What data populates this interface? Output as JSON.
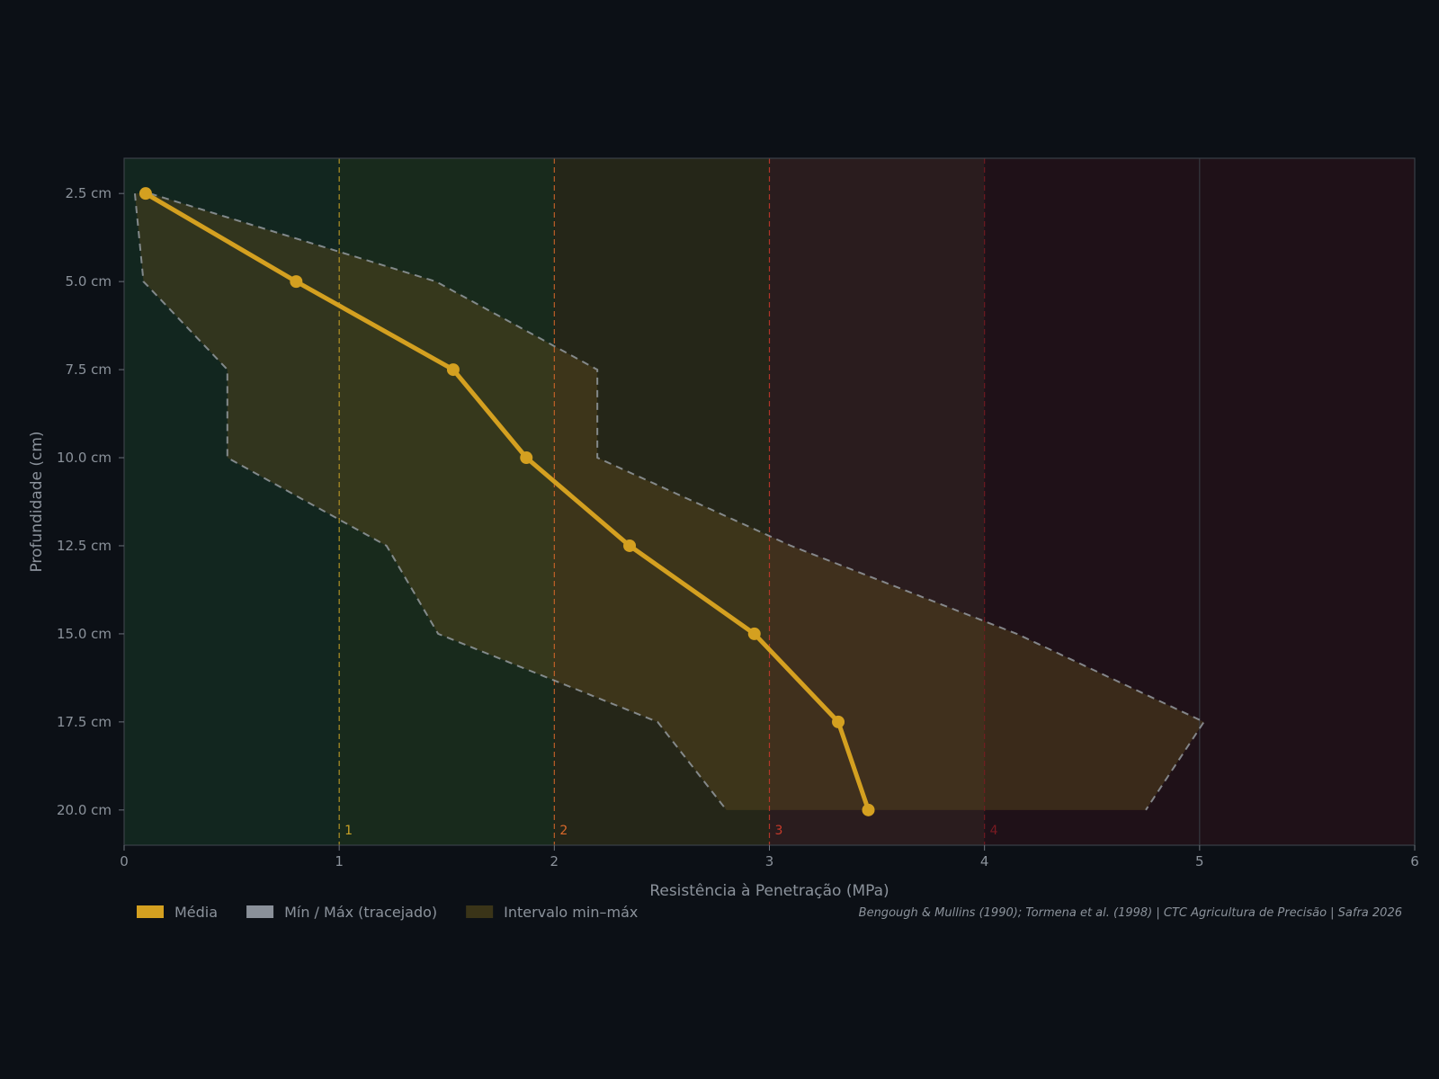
{
  "chart_data": {
    "type": "line",
    "title": "",
    "xlabel": "Resistência à Penetração (MPa)",
    "ylabel": "Profundidade (cm)",
    "xlim": [
      0,
      6
    ],
    "ylim": [
      21,
      1.5
    ],
    "y_inverted": true,
    "x_ticks": [
      "0",
      "1",
      "2",
      "3",
      "4",
      "5",
      "6"
    ],
    "y_ticks": [
      {
        "value": 2.5,
        "label": "2.5 cm"
      },
      {
        "value": 5.0,
        "label": "5.0 cm"
      },
      {
        "value": 7.5,
        "label": "7.5 cm"
      },
      {
        "value": 10.0,
        "label": "10.0 cm"
      },
      {
        "value": 12.5,
        "label": "12.5 cm"
      },
      {
        "value": 15.0,
        "label": "15.0 cm"
      },
      {
        "value": 17.5,
        "label": "17.5 cm"
      },
      {
        "value": 20.0,
        "label": "20.0 cm"
      }
    ],
    "depths": [
      2.5,
      5.0,
      7.5,
      10.0,
      12.5,
      15.0,
      17.5,
      20.0
    ],
    "zones": [
      {
        "from": 0,
        "to": 1,
        "color": "#12261f"
      },
      {
        "from": 1,
        "to": 2,
        "color": "#182a1c"
      },
      {
        "from": 2,
        "to": 3,
        "color": "#252618"
      },
      {
        "from": 3,
        "to": 4,
        "color": "#2a1c1e"
      },
      {
        "from": 4,
        "to": 6,
        "color": "#1f1118"
      }
    ],
    "thresholds": [
      {
        "value": 1,
        "label": "1",
        "color": "#c9a227"
      },
      {
        "value": 2,
        "label": "2",
        "color": "#d9682a"
      },
      {
        "value": 3,
        "label": "3",
        "color": "#c83a2a"
      },
      {
        "value": 4,
        "label": "4",
        "color": "#7a1a22"
      }
    ],
    "series": [
      {
        "name": "Média",
        "color": "#d4a020",
        "values": [
          0.1,
          0.8,
          1.53,
          1.87,
          2.35,
          2.93,
          3.32,
          3.46
        ]
      },
      {
        "name": "Mín",
        "color": "#9aa0a6",
        "values": [
          0.05,
          0.09,
          0.48,
          0.48,
          1.22,
          1.46,
          2.48,
          2.8
        ]
      },
      {
        "name": "Máx",
        "color": "#9aa0a6",
        "values": [
          0.12,
          1.45,
          2.2,
          2.2,
          3.1,
          4.15,
          5.02,
          4.75
        ]
      }
    ],
    "band_color": "#5b4a1c",
    "legend": [
      {
        "label": "Média",
        "swatch": "#d4a020"
      },
      {
        "label": "Mín / Máx  (tracejado)",
        "swatch": "#8a9099"
      },
      {
        "label": "Intervalo min–máx",
        "swatch": "#3a3418"
      }
    ],
    "legend_placement": "bottom-left",
    "source": "Bengough & Mullins (1990); Tormena et al. (1998)  |  CTC Agricultura de Precisão  |  Safra 2026",
    "grid": false
  }
}
